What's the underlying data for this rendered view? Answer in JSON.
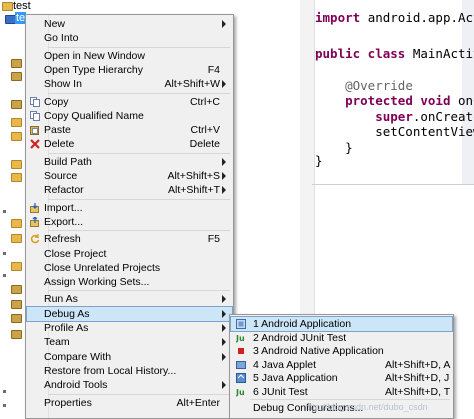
{
  "explorer": {
    "items": [
      {
        "label": "test"
      },
      {
        "label": "te"
      }
    ]
  },
  "editor": {
    "lines": [
      {
        "parts": [
          {
            "t": "import ",
            "c": "kw"
          },
          {
            "t": "android.app.Act",
            "c": ""
          }
        ]
      },
      {
        "parts": [
          {
            "t": "",
            "c": ""
          }
        ]
      },
      {
        "parts": [
          {
            "t": "public class ",
            "c": "kw"
          },
          {
            "t": "MainActiv",
            "c": ""
          }
        ]
      },
      {
        "parts": [
          {
            "t": "",
            "c": ""
          }
        ]
      },
      {
        "parts": [
          {
            "t": "    ",
            "c": ""
          },
          {
            "t": "@Override",
            "c": "ann"
          }
        ]
      },
      {
        "parts": [
          {
            "t": "    ",
            "c": ""
          },
          {
            "t": "protected void ",
            "c": "kw"
          },
          {
            "t": "onC",
            "c": ""
          }
        ]
      },
      {
        "parts": [
          {
            "t": "        ",
            "c": ""
          },
          {
            "t": "super",
            "c": "kw"
          },
          {
            "t": ".onCreate",
            "c": ""
          }
        ]
      },
      {
        "parts": [
          {
            "t": "        setContentView",
            "c": ""
          }
        ]
      },
      {
        "parts": [
          {
            "t": "    }",
            "c": ""
          }
        ]
      },
      {
        "parts": [
          {
            "t": "}",
            "c": ""
          }
        ]
      }
    ]
  },
  "menu": {
    "items": [
      {
        "label": "New",
        "submenu": true,
        "icon": ""
      },
      {
        "label": "Go Into",
        "icon": ""
      },
      {
        "sep": true
      },
      {
        "label": "Open in New Window",
        "icon": ""
      },
      {
        "label": "Open Type Hierarchy",
        "acc": "F4",
        "icon": ""
      },
      {
        "label": "Show In",
        "acc": "Alt+Shift+W",
        "submenu": true,
        "icon": ""
      },
      {
        "sep": true
      },
      {
        "label": "Copy",
        "acc": "Ctrl+C",
        "icon": "copy-icon"
      },
      {
        "label": "Copy Qualified Name",
        "icon": "copy-icon"
      },
      {
        "label": "Paste",
        "acc": "Ctrl+V",
        "icon": "paste-icon"
      },
      {
        "label": "Delete",
        "acc": "Delete",
        "icon": "delete-icon"
      },
      {
        "sep": true
      },
      {
        "label": "Build Path",
        "submenu": true,
        "icon": ""
      },
      {
        "label": "Source",
        "acc": "Alt+Shift+S",
        "submenu": true,
        "icon": ""
      },
      {
        "label": "Refactor",
        "acc": "Alt+Shift+T",
        "submenu": true,
        "icon": ""
      },
      {
        "sep": true
      },
      {
        "label": "Import...",
        "icon": "import-icon"
      },
      {
        "label": "Export...",
        "icon": "export-icon"
      },
      {
        "sep": true
      },
      {
        "label": "Refresh",
        "acc": "F5",
        "icon": "refresh-icon"
      },
      {
        "label": "Close Project",
        "icon": ""
      },
      {
        "label": "Close Unrelated Projects",
        "icon": ""
      },
      {
        "label": "Assign Working Sets...",
        "icon": ""
      },
      {
        "sep": true
      },
      {
        "label": "Run As",
        "submenu": true,
        "icon": ""
      },
      {
        "label": "Debug As",
        "submenu": true,
        "hover": true,
        "icon": ""
      },
      {
        "label": "Profile As",
        "submenu": true,
        "icon": ""
      },
      {
        "label": "Team",
        "submenu": true,
        "icon": ""
      },
      {
        "label": "Compare With",
        "submenu": true,
        "icon": ""
      },
      {
        "label": "Restore from Local History...",
        "icon": ""
      },
      {
        "label": "Android Tools",
        "submenu": true,
        "icon": ""
      },
      {
        "sep": true
      },
      {
        "label": "Properties",
        "acc": "Alt+Enter",
        "icon": ""
      }
    ]
  },
  "submenu": {
    "items": [
      {
        "label": "1 Android Application",
        "hover": true,
        "icon": "android-app-icon"
      },
      {
        "label": "2 Android JUnit Test",
        "icon": "junit-icon"
      },
      {
        "label": "3 Android Native Application",
        "icon": "native-app-icon"
      },
      {
        "label": "4 Java Applet",
        "acc": "Alt+Shift+D, A",
        "icon": "applet-icon"
      },
      {
        "label": "5 Java Application",
        "acc": "Alt+Shift+D, J",
        "icon": "java-app-icon"
      },
      {
        "label": "6 JUnit Test",
        "acc": "Alt+Shift+D, T",
        "icon": "junit-icon"
      },
      {
        "sep": true
      },
      {
        "label": "Debug Configurations...",
        "icon": ""
      }
    ]
  },
  "watermark": "http://blog.csdn.net/dubo_csdn",
  "colors": {
    "hover_bg": "#cde6f7",
    "hover_border": "#7da2ce",
    "menu_bg": "#f0f0f0"
  }
}
